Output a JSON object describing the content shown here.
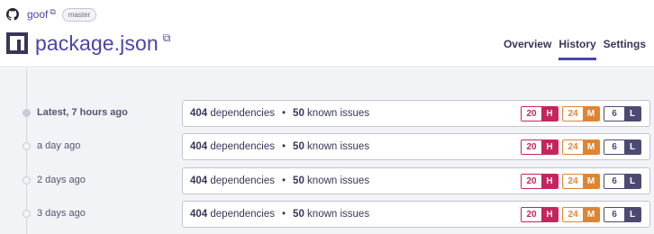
{
  "header": {
    "repo_name": "goof",
    "branch": "master",
    "title": "package.json"
  },
  "tabs": [
    {
      "label": "Overview"
    },
    {
      "label": "History"
    },
    {
      "label": "Settings"
    }
  ],
  "colors": {
    "accent": "#4b45a9",
    "high": "#c4255f",
    "medium": "#df8432",
    "low": "#4c4a73"
  },
  "history": [
    {
      "label": "Latest, 7 hours ago",
      "dependencies": "404",
      "dependencies_label": "dependencies",
      "issues": "50",
      "issues_label": "known issues",
      "high": "20",
      "high_label": "H",
      "medium": "24",
      "medium_label": "M",
      "low": "6",
      "low_label": "L"
    },
    {
      "label": "a day ago",
      "dependencies": "404",
      "dependencies_label": "dependencies",
      "issues": "50",
      "issues_label": "known issues",
      "high": "20",
      "high_label": "H",
      "medium": "24",
      "medium_label": "M",
      "low": "6",
      "low_label": "L"
    },
    {
      "label": "2 days ago",
      "dependencies": "404",
      "dependencies_label": "dependencies",
      "issues": "50",
      "issues_label": "known issues",
      "high": "20",
      "high_label": "H",
      "medium": "24",
      "medium_label": "M",
      "low": "6",
      "low_label": "L"
    },
    {
      "label": "3 days ago",
      "dependencies": "404",
      "dependencies_label": "dependencies",
      "issues": "50",
      "issues_label": "known issues",
      "high": "20",
      "high_label": "H",
      "medium": "24",
      "medium_label": "M",
      "low": "6",
      "low_label": "L"
    }
  ]
}
